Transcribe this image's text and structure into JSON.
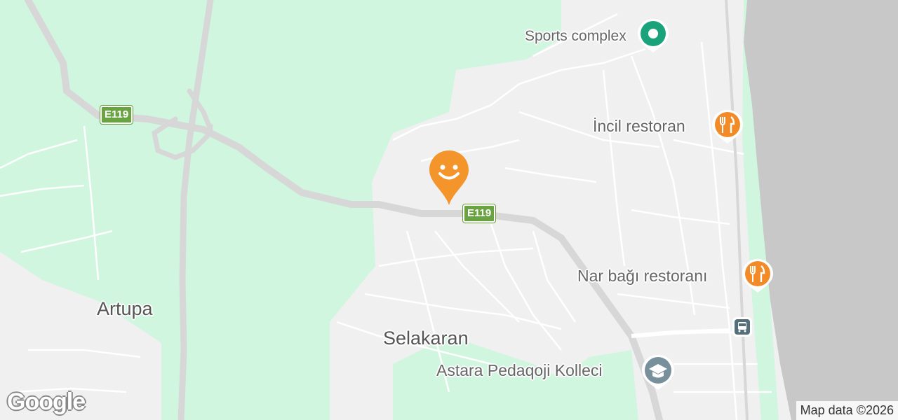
{
  "map": {
    "areas": [
      "Artupa",
      "Selakaran"
    ],
    "pois": {
      "sports": "Sports complex",
      "incil": "İncil restoran",
      "nar": "Nar bağı restoranı",
      "college": "Astara Pedaqoji Kolleci"
    },
    "road_shields": [
      "E119",
      "E119"
    ],
    "attribution": "Map data ©2026",
    "logo": "Google"
  },
  "colors": {
    "greenspace": "#d0f6e0",
    "land": "#f1f0f1",
    "sea": "#c8c8c8",
    "road": "#d7d7d7",
    "minor_road": "#ffffff",
    "highway_shield": "#6aa342",
    "restaurant_pin": "#f28b27",
    "sports_pin": "#1aa37a",
    "school_pin": "#78909c",
    "transit_pin": "#546e7a"
  },
  "icons": [
    "smiley-pin-icon",
    "restaurant-icon",
    "sports-pin-icon",
    "school-icon",
    "bus-icon"
  ]
}
